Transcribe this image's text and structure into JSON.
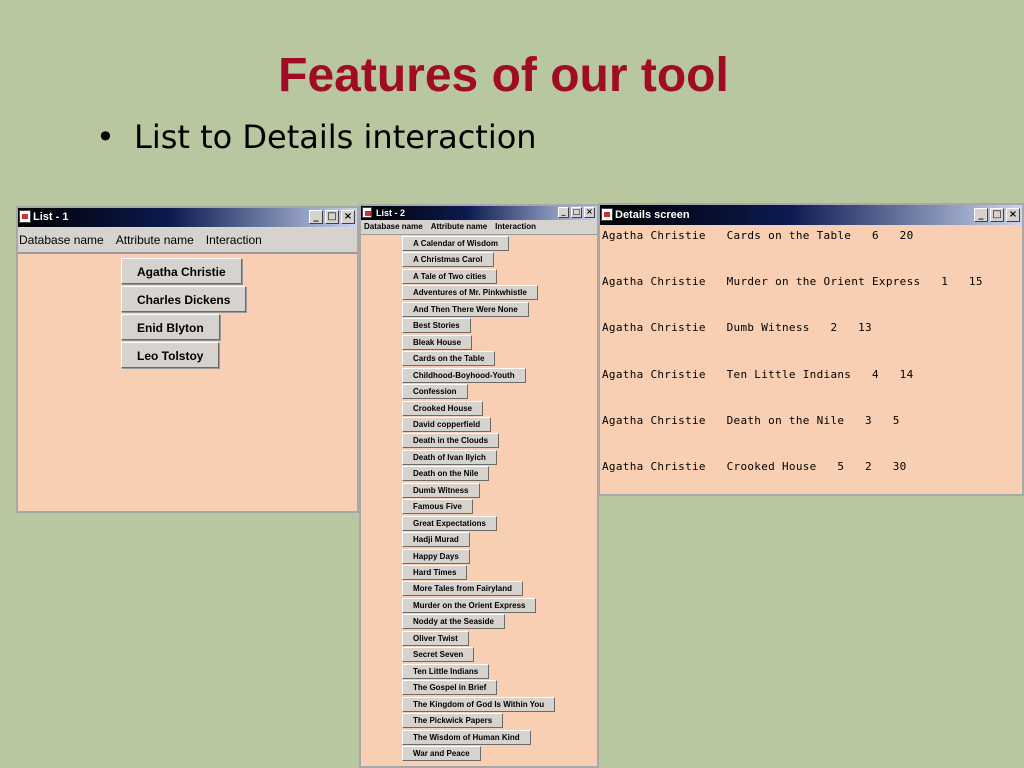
{
  "slide": {
    "title": "Features of our tool",
    "bullet_symbol": "•",
    "bullet": "List to Details interaction"
  },
  "colors": {
    "background": "#b8c7a0",
    "title": "#a00c24",
    "window_body": "#f9cfb3",
    "button_face": "#d6d3ce"
  },
  "window_list1": {
    "title": "List - 1",
    "menu": [
      "Database name",
      "Attribute name",
      "Interaction"
    ],
    "authors": [
      "Agatha Christie",
      "Charles Dickens",
      "Enid Blyton",
      "Leo Tolstoy"
    ],
    "controls": {
      "minimize": "_",
      "maximize": "□",
      "close": "×"
    }
  },
  "window_list2": {
    "title": "List - 2",
    "menu": [
      "Database name",
      "Attribute name",
      "Interaction"
    ],
    "books": [
      "A Calendar of Wisdom",
      "A Christmas Carol",
      "A Tale of Two cities",
      "Adventures of Mr. Pinkwhistle",
      "And Then There Were None",
      "Best Stories",
      "Bleak House",
      "Cards on the Table",
      "Childhood-Boyhood-Youth",
      "Confession",
      "Crooked House",
      "David copperfield",
      "Death in the Clouds",
      "Death of Ivan Ilyich",
      "Death on the Nile",
      "Dumb Witness",
      "Famous Five",
      "Great Expectations",
      "Hadji Murad",
      "Happy Days",
      "Hard Times",
      "More Tales from Fairyland",
      "Murder on the Orient Express",
      "Noddy at the Seaside",
      "Oliver Twist",
      "Secret Seven",
      "Ten Little Indians",
      "The Gospel in Brief",
      "The Kingdom of God Is Within You",
      "The Pickwick Papers",
      "The Wisdom of Human Kind",
      "War and Peace"
    ],
    "controls": {
      "minimize": "_",
      "maximize": "□",
      "close": "×"
    }
  },
  "window_details": {
    "title": "Details screen",
    "rows": [
      "Agatha Christie   Cards on the Table   6   20",
      "Agatha Christie   Murder on the Orient Express   1   15",
      "Agatha Christie   Dumb Witness   2   13",
      "Agatha Christie   Ten Little Indians   4   14",
      "Agatha Christie   Death on the Nile   3   5",
      "Agatha Christie   Crooked House   5   2   30"
    ],
    "controls": {
      "minimize": "_",
      "maximize": "□",
      "close": "×"
    }
  }
}
